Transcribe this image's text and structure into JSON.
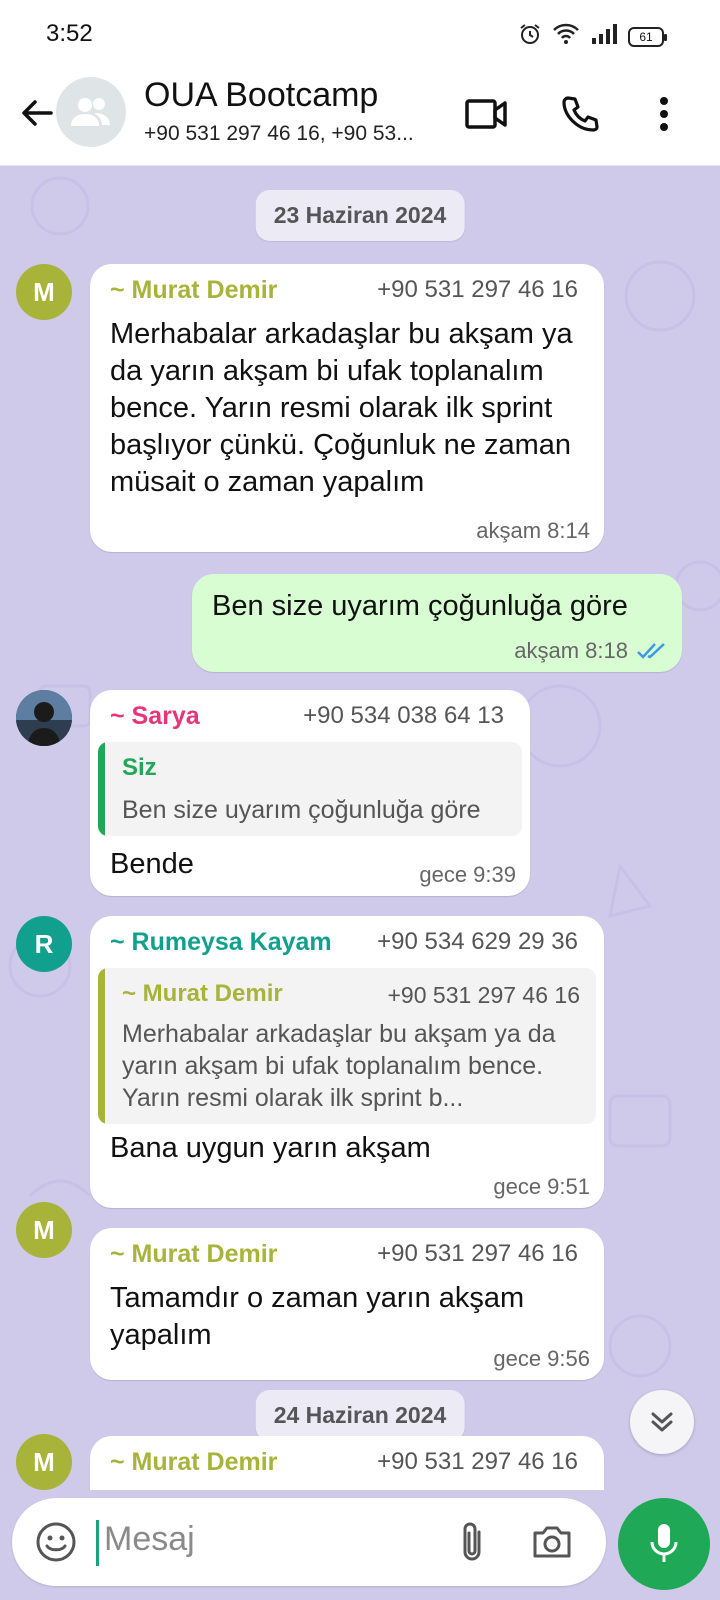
{
  "status_bar": {
    "time": "3:52",
    "battery": "61"
  },
  "header": {
    "title": "OUA Bootcamp",
    "subtitle": "+90 531 297 46 16, +90 53..."
  },
  "chat": {
    "date_1": "23 Haziran 2024",
    "date_2": "24 Haziran 2024",
    "messages": [
      {
        "avatar_letter": "M",
        "sender": "~ Murat Demir",
        "phone": "+90 531 297 46 16",
        "text": "Merhabalar arkadaşlar bu akşam ya da yarın akşam bi ufak toplanalım bence. Yarın resmi olarak ilk sprint başlıyor çünkü. Çoğunluk ne zaman müsait o zaman yapalım",
        "time": "akşam 8:14"
      },
      {
        "text": "Ben size uyarım çoğunluğa göre",
        "time": "akşam 8:18"
      },
      {
        "sender": "~ Sarya",
        "phone": "+90 534 038 64 13",
        "quote_name": "Siz",
        "quote_text": "Ben size uyarım çoğunluğa göre",
        "text": "Bende",
        "time": "gece 9:39"
      },
      {
        "avatar_letter": "R",
        "sender": "~ Rumeysa Kayam",
        "phone": "+90 534 629 29 36",
        "quote_name": "~ Murat Demir",
        "quote_phone": "+90 531 297 46 16",
        "quote_text": "Merhabalar arkadaşlar bu akşam ya da yarın akşam bi ufak toplanalım bence. Yarın resmi olarak ilk sprint b...",
        "text": "Bana uygun yarın akşam",
        "time": "gece 9:51"
      },
      {
        "avatar_letter": "M",
        "sender": "~ Murat Demir",
        "phone": "+90 531 297 46 16",
        "text": "Tamamdır o zaman yarın akşam yapalım",
        "time": "gece 9:56"
      },
      {
        "avatar_letter": "M",
        "sender": "~ Murat Demir",
        "phone": "+90 531 297 46 16"
      }
    ]
  },
  "input": {
    "placeholder": "Mesaj"
  },
  "colors": {
    "murat": "#a8b33a",
    "sarya": "#e8347a",
    "rumeysa": "#12a08e",
    "siz": "#1fa855",
    "chat_bg": "#cfc9ea",
    "outgoing": "#d9fdd3",
    "read_ticks": "#3b9ae8"
  },
  "icons": [
    "back-arrow-icon",
    "group-icon",
    "video-call-icon",
    "phone-call-icon",
    "more-vert-icon",
    "emoji-icon",
    "attach-icon",
    "camera-icon",
    "mic-icon",
    "double-chevron-down-icon",
    "alarm-icon",
    "wifi-icon",
    "signal-icon",
    "battery-icon"
  ]
}
